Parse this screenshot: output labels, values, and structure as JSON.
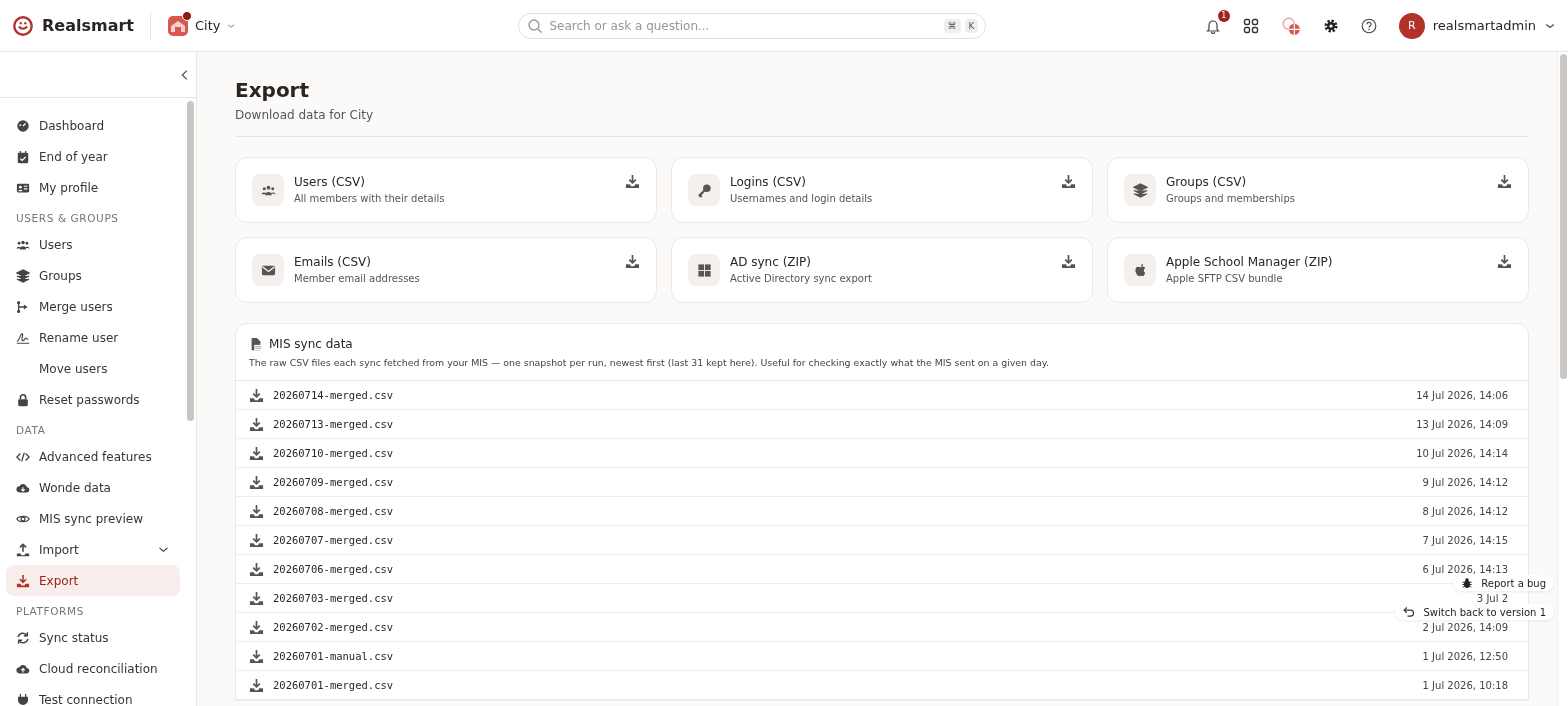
{
  "header": {
    "brand": "Realsmart",
    "org": "City",
    "search": {
      "placeholder": "Search or ask a question..."
    },
    "shortcut": [
      "⌘",
      "K"
    ],
    "notifications": "1",
    "user": {
      "initial": "R",
      "name": "realsmartadmin"
    }
  },
  "sidebar": {
    "sections": [
      {
        "items": [
          {
            "label": "Dashboard",
            "kind": "link",
            "selected": false
          },
          {
            "label": "End of year",
            "kind": "link",
            "selected": false
          },
          {
            "label": "My profile",
            "kind": "link",
            "selected": false
          }
        ]
      },
      {
        "heading": "USERS & GROUPS",
        "items": [
          {
            "label": "Users",
            "kind": "link",
            "selected": false
          },
          {
            "label": "Groups",
            "kind": "link",
            "selected": false
          },
          {
            "label": "Merge users",
            "kind": "link",
            "selected": false
          },
          {
            "label": "Rename user",
            "kind": "link",
            "selected": false
          },
          {
            "label": "Move users",
            "kind": "link",
            "selected": false
          },
          {
            "label": "Reset passwords",
            "kind": "link",
            "selected": false
          }
        ]
      },
      {
        "heading": "DATA",
        "items": [
          {
            "label": "Advanced features",
            "kind": "link",
            "selected": false
          },
          {
            "label": "Wonde data",
            "kind": "link",
            "selected": false
          },
          {
            "label": "MIS sync preview",
            "kind": "link",
            "selected": false
          },
          {
            "label": "Import",
            "kind": "group",
            "selected": false
          },
          {
            "label": "Export",
            "kind": "link",
            "selected": true
          }
        ]
      },
      {
        "heading": "PLATFORMS",
        "items": [
          {
            "label": "Sync status",
            "kind": "link",
            "selected": false
          },
          {
            "label": "Cloud reconciliation",
            "kind": "link",
            "selected": false
          },
          {
            "label": "Test connection",
            "kind": "link",
            "selected": false
          }
        ]
      }
    ]
  },
  "page": {
    "title": "Export",
    "subtitle": "Download data for City"
  },
  "exports": [
    {
      "title": "Users (CSV)",
      "description": "All members with their details"
    },
    {
      "title": "Logins (CSV)",
      "description": "Usernames and login details"
    },
    {
      "title": "Groups (CSV)",
      "description": "Groups and memberships"
    },
    {
      "title": "Emails (CSV)",
      "description": "Member email addresses"
    },
    {
      "title": "AD sync (ZIP)",
      "description": "Active Directory sync export"
    },
    {
      "title": "Apple School Manager (ZIP)",
      "description": "Apple SFTP CSV bundle"
    }
  ],
  "mis_sync": {
    "title": "MIS sync data",
    "description": "The raw CSV files each sync fetched from your MIS — one snapshot per run, newest first (last 31 kept here). Useful for checking exactly what the MIS sent on a given day.",
    "files": [
      {
        "name": "20260714-merged.csv",
        "date": "14 Jul 2026, 14:06"
      },
      {
        "name": "20260713-merged.csv",
        "date": "13 Jul 2026, 14:09"
      },
      {
        "name": "20260710-merged.csv",
        "date": "10 Jul 2026, 14:14"
      },
      {
        "name": "20260709-merged.csv",
        "date": "9 Jul 2026, 14:12"
      },
      {
        "name": "20260708-merged.csv",
        "date": "8 Jul 2026, 14:12"
      },
      {
        "name": "20260707-merged.csv",
        "date": "7 Jul 2026, 14:15"
      },
      {
        "name": "20260706-merged.csv",
        "date": "6 Jul 2026, 14:13"
      },
      {
        "name": "20260703-merged.csv",
        "date": "3 Jul 2"
      },
      {
        "name": "20260702-merged.csv",
        "date": "2 Jul 2026, 14:09"
      },
      {
        "name": "20260701-manual.csv",
        "date": "1 Jul 2026, 12:50"
      },
      {
        "name": "20260701-merged.csv",
        "date": "1 Jul 2026, 10:18"
      }
    ]
  },
  "floating": [
    {
      "label": "Report a bug"
    },
    {
      "label": "Switch back to version 1"
    }
  ]
}
